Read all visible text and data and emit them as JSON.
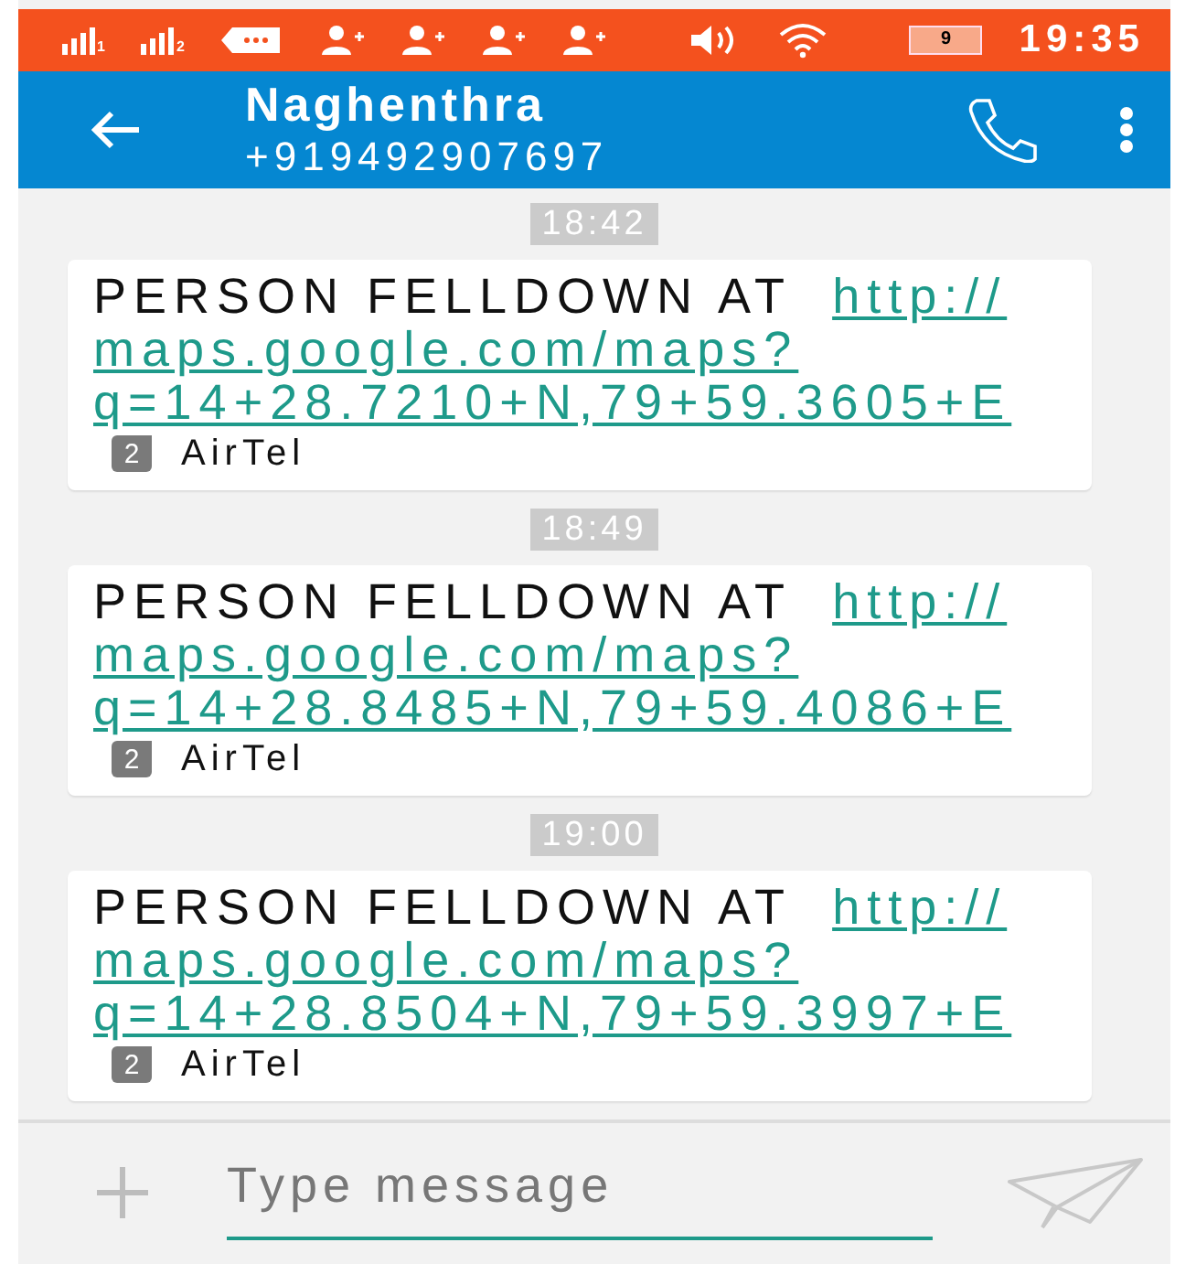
{
  "status_bar": {
    "sim_slots": [
      "1",
      "2"
    ],
    "battery": "9",
    "time": "19:35"
  },
  "header": {
    "name": "Naghenthra",
    "number": "+919492907697"
  },
  "messages": [
    {
      "time": "18:42",
      "text": "PERSON FELLDOWN AT",
      "link_lines": [
        "http://",
        "maps.google.com/maps?",
        "q=14+28.7210+N,79+59.3605+E"
      ],
      "sim": "2",
      "carrier": "AirTel"
    },
    {
      "time": "18:49",
      "text": "PERSON FELLDOWN AT",
      "link_lines": [
        "http://",
        "maps.google.com/maps?",
        "q=14+28.8485+N,79+59.4086+E"
      ],
      "sim": "2",
      "carrier": "AirTel"
    },
    {
      "time": "19:00",
      "text": "PERSON FELLDOWN AT",
      "link_lines": [
        "http://",
        "maps.google.com/maps?",
        "q=14+28.8504+N,79+59.3997+E"
      ],
      "sim": "2",
      "carrier": "AirTel"
    }
  ],
  "composer": {
    "placeholder": "Type message"
  }
}
